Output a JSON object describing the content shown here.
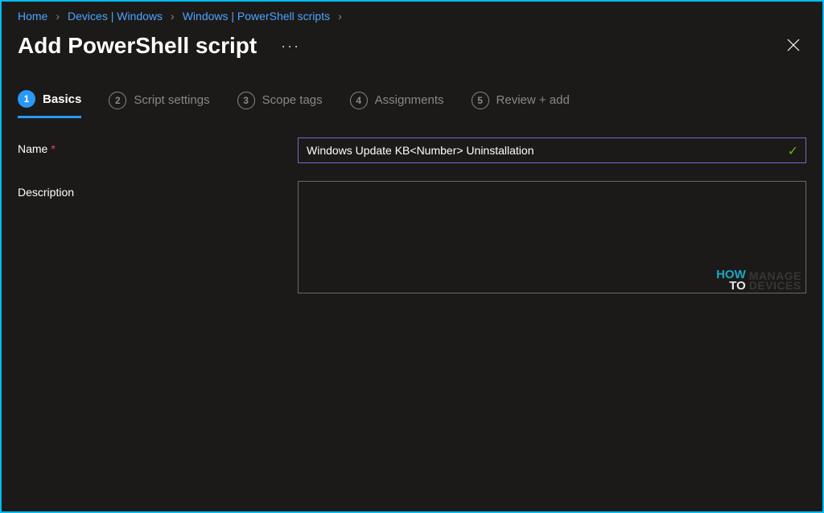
{
  "breadcrumb": {
    "items": [
      {
        "label": "Home"
      },
      {
        "label": "Devices | Windows"
      },
      {
        "label": "Windows | PowerShell scripts"
      }
    ]
  },
  "header": {
    "title": "Add PowerShell script",
    "ellipsis": "···"
  },
  "tabs": [
    {
      "num": "1",
      "label": "Basics",
      "active": true
    },
    {
      "num": "2",
      "label": "Script settings",
      "active": false
    },
    {
      "num": "3",
      "label": "Scope tags",
      "active": false
    },
    {
      "num": "4",
      "label": "Assignments",
      "active": false
    },
    {
      "num": "5",
      "label": "Review + add",
      "active": false
    }
  ],
  "form": {
    "name_label": "Name",
    "name_required": "*",
    "name_value": "Windows Update KB<Number> Uninstallation",
    "description_label": "Description",
    "description_value": ""
  },
  "watermark": {
    "how": "HOW",
    "to": "TO",
    "manage_line1": "MANAGE",
    "manage_line2": "DEVICES"
  },
  "colors": {
    "accent": "#2899f5",
    "border": "#00bcf2",
    "success": "#6bb700",
    "focus_border": "#8461c9"
  }
}
